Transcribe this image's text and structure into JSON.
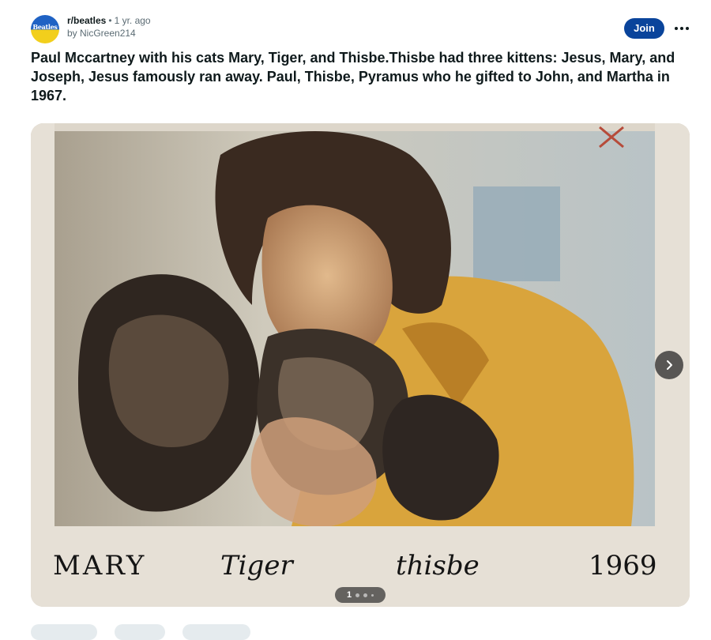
{
  "post": {
    "subreddit": "r/beatles",
    "separator": "•",
    "age": "1 yr. ago",
    "author": "by NicGreen214",
    "avatar_text": "Beatles",
    "join_label": "Join",
    "title": "Paul Mccartney with his cats Mary, Tiger, and Thisbe.Thisbe had three kittens: Jesus, Mary, and Joseph, Jesus famously ran away. Paul, Thisbe, Pyramus who he gifted to John, and Martha in 1967."
  },
  "media": {
    "caption_words": [
      "MARY",
      "Tiger",
      "thisbe",
      "1969"
    ],
    "pager_current": "1",
    "next_icon": "chevron-right-icon",
    "more_icon": "ellipsis-icon"
  },
  "colors": {
    "join_bg": "#0a449b",
    "sweater": "#d9a43c",
    "photo_bg": "#c9c3b6"
  }
}
